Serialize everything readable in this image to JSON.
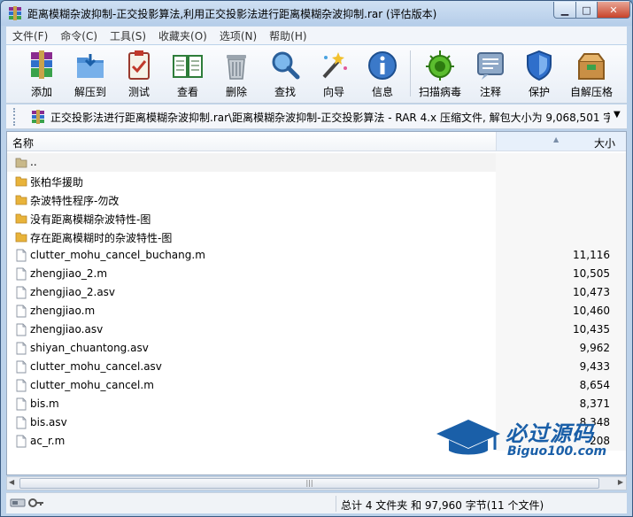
{
  "title": "距离模糊杂波抑制-正交投影算法,利用正交投影法进行距离模糊杂波抑制.rar (评估版本)",
  "window_buttons": {
    "minimize": "▁",
    "maximize": "□",
    "close": "✕"
  },
  "menu": [
    "文件(F)",
    "命令(C)",
    "工具(S)",
    "收藏夹(O)",
    "选项(N)",
    "帮助(H)"
  ],
  "toolbar": [
    {
      "label": "添加",
      "icon": "add-archive-icon"
    },
    {
      "label": "解压到",
      "icon": "extract-folder-icon"
    },
    {
      "label": "测试",
      "icon": "test-clipboard-icon"
    },
    {
      "label": "查看",
      "icon": "view-book-icon"
    },
    {
      "label": "删除",
      "icon": "trash-icon"
    },
    {
      "label": "查找",
      "icon": "magnifier-icon"
    },
    {
      "label": "向导",
      "icon": "wizard-wand-icon"
    },
    {
      "label": "信息",
      "icon": "info-icon"
    },
    {
      "label": "扫描病毒",
      "icon": "virus-scan-icon"
    },
    {
      "label": "注释",
      "icon": "comment-icon"
    },
    {
      "label": "保护",
      "icon": "shield-icon"
    },
    {
      "label": "自解压格",
      "icon": "sfx-box-icon"
    }
  ],
  "address": "正交投影法进行距离模糊杂波抑制.rar\\距离模糊杂波抑制-正交投影算法 - RAR 4.x 压缩文件, 解包大小为 9,068,501 字节",
  "columns": {
    "name": "名称",
    "size": "大小"
  },
  "files": [
    {
      "name": "..",
      "size": "",
      "type": "up"
    },
    {
      "name": "张柏华援助",
      "size": "",
      "type": "folder"
    },
    {
      "name": "杂波特性程序-勿改",
      "size": "",
      "type": "folder"
    },
    {
      "name": "没有距离模糊杂波特性-图",
      "size": "",
      "type": "folder"
    },
    {
      "name": "存在距离模糊时的杂波特性-图",
      "size": "",
      "type": "folder"
    },
    {
      "name": "clutter_mohu_cancel_buchang.m",
      "size": "11,116",
      "type": "file"
    },
    {
      "name": "zhengjiao_2.m",
      "size": "10,505",
      "type": "file"
    },
    {
      "name": "zhengjiao_2.asv",
      "size": "10,473",
      "type": "file"
    },
    {
      "name": "zhengjiao.m",
      "size": "10,460",
      "type": "file"
    },
    {
      "name": "zhengjiao.asv",
      "size": "10,435",
      "type": "file"
    },
    {
      "name": "shiyan_chuantong.asv",
      "size": "9,962",
      "type": "file"
    },
    {
      "name": "clutter_mohu_cancel.asv",
      "size": "9,433",
      "type": "file"
    },
    {
      "name": "clutter_mohu_cancel.m",
      "size": "8,654",
      "type": "file"
    },
    {
      "name": "bis.m",
      "size": "8,371",
      "type": "file"
    },
    {
      "name": "bis.asv",
      "size": "8,348",
      "type": "file"
    },
    {
      "name": "ac_r.m",
      "size": "208",
      "type": "file"
    }
  ],
  "status": "总计 4 文件夹 和 97,960 字节(11 个文件)",
  "watermark": {
    "title": "必过源码",
    "sub": "Biguo100.com"
  },
  "colors": {
    "accent": "#1a5fa8",
    "folder": "#e8b33a"
  }
}
